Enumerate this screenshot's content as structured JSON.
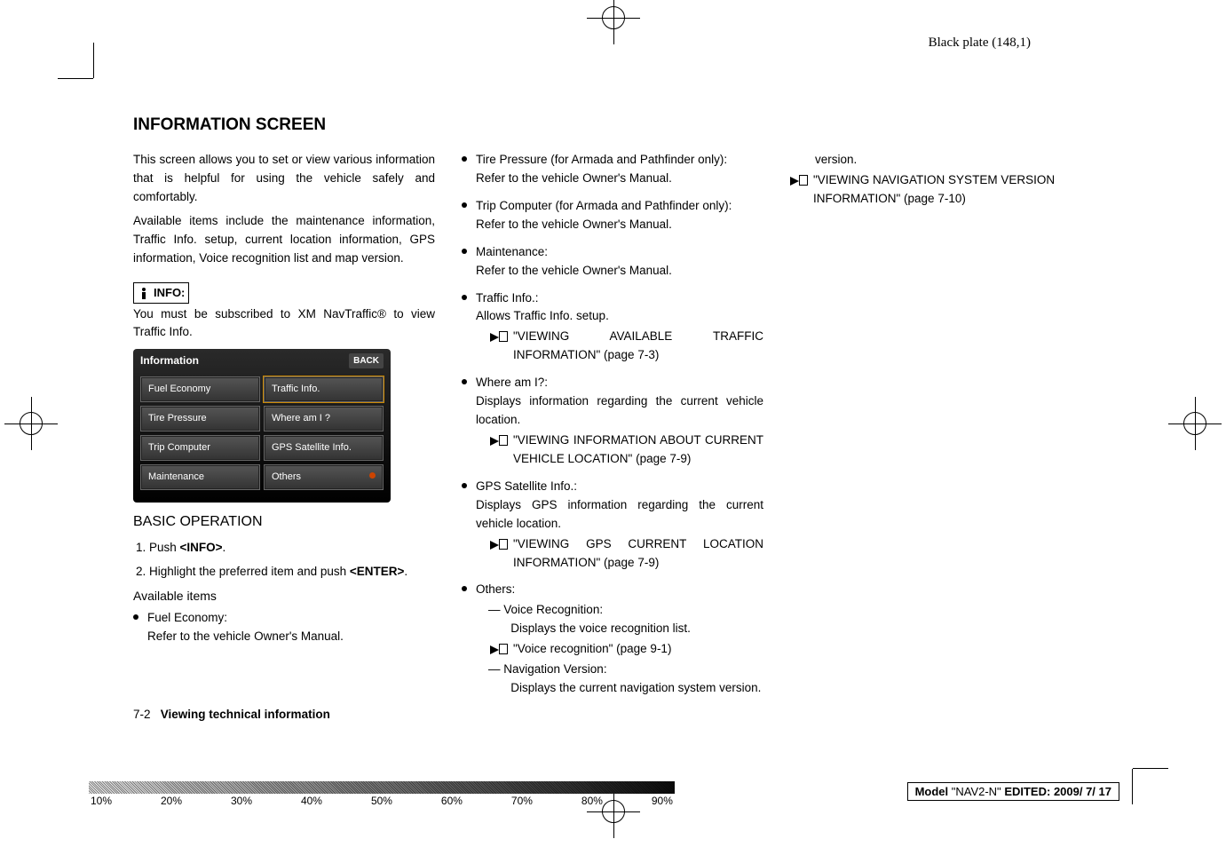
{
  "plate_label": "Black plate (148,1)",
  "section_title": "INFORMATION SCREEN",
  "intro_p1": "This screen allows you to set or view various information that is helpful for using the vehicle safely and comfortably.",
  "intro_p2": "Available items include the maintenance information, Traffic Info. setup, current location information, GPS information, Voice recognition list and map version.",
  "info_label": "INFO:",
  "info_text": "You must be subscribed to XM NavTraffic® to view Traffic Info.",
  "screenshot": {
    "title": "Information",
    "back": "BACK",
    "cells": {
      "fuel": "Fuel Economy",
      "traffic": "Traffic Info.",
      "tire": "Tire Pressure",
      "where": "Where am I ?",
      "trip": "Trip Computer",
      "gps": "GPS Satellite Info.",
      "maint": "Maintenance",
      "others": "Others"
    }
  },
  "basic_op_h": "BASIC OPERATION",
  "step1": "Push <INFO>.",
  "step2": "Highlight the preferred item and push <ENTER>.",
  "avail_h": "Available items",
  "items": {
    "fuel": {
      "t": "Fuel Economy:",
      "d": "Refer to the vehicle Owner's Manual."
    },
    "tire": {
      "t": "Tire Pressure (for Armada and Pathfinder only):",
      "d": "Refer to the vehicle Owner's Manual."
    },
    "trip": {
      "t": "Trip Computer (for Armada and Pathfinder only):",
      "d": "Refer to the vehicle Owner's Manual."
    },
    "maint": {
      "t": "Maintenance:",
      "d": "Refer to the vehicle Owner's Manual."
    },
    "traffic": {
      "t": "Traffic Info.:",
      "d": "Allows Traffic Info. setup.",
      "ref": "\"VIEWING AVAILABLE TRAFFIC INFORMATION\" (page 7-3)"
    },
    "where": {
      "t": "Where am I?:",
      "d": "Displays information regarding the current vehicle location.",
      "ref": "\"VIEWING INFORMATION ABOUT CURRENT VEHICLE LOCATION\" (page 7-9)"
    },
    "gps": {
      "t": "GPS Satellite Info.:",
      "d": "Displays GPS information regarding the current vehicle location.",
      "ref": "\"VIEWING GPS CURRENT LOCATION INFORMATION\" (page 7-9)"
    },
    "others": {
      "t": "Others:",
      "voice": {
        "t": "— Voice Recognition:",
        "d": "Displays the voice recognition list.",
        "ref": "\"Voice recognition\" (page 9-1)"
      },
      "nav": {
        "t": "— Navigation Version:",
        "d": "Displays the current navigation system version.",
        "ref": "\"VIEWING NAVIGATION SYSTEM VERSION INFORMATION\" (page 7-10)"
      }
    }
  },
  "footer_page": "7-2",
  "footer_title": "Viewing technical information",
  "model_line": {
    "pre": "Model ",
    "model": "\"NAV2-N\"",
    "mid": " EDITED: ",
    "date": "2009/ 7/ 17"
  },
  "density": [
    "10%",
    "20%",
    "30%",
    "40%",
    "50%",
    "60%",
    "70%",
    "80%",
    "90%"
  ]
}
